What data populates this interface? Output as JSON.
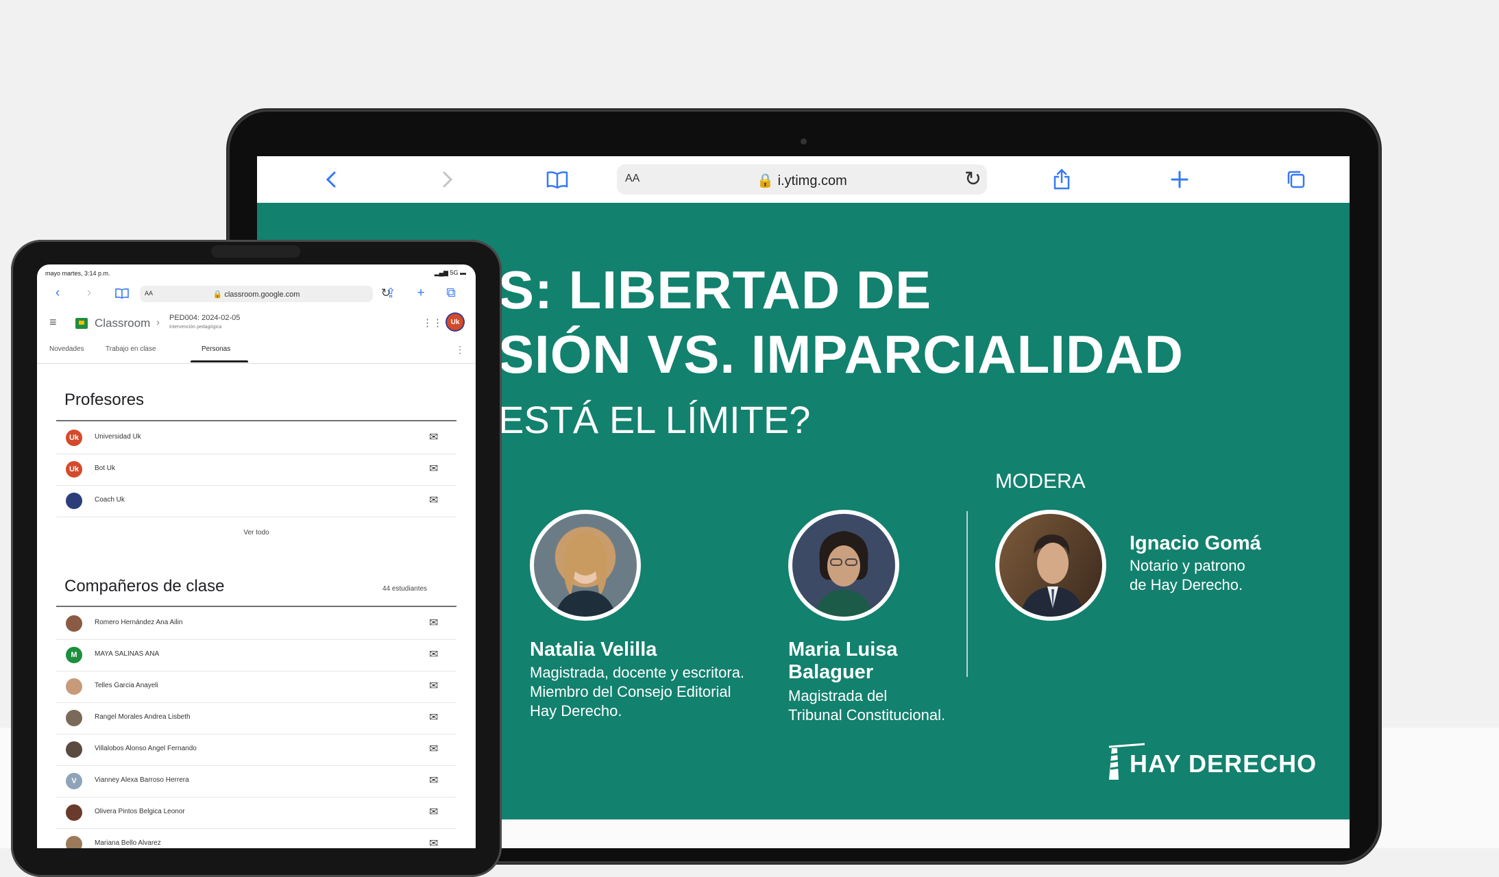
{
  "laptop_browser": {
    "text_size_label": "AA",
    "url": "i.ytimg.com",
    "icons": [
      "back-icon",
      "forward-icon",
      "bookmarks-icon",
      "reload-icon",
      "share-icon",
      "new-tab-icon",
      "tabs-icon"
    ]
  },
  "slide": {
    "title_line1": "S: LIBERTAD DE",
    "title_line2": "SIÓN VS. IMPARCIALIDAD",
    "title_line3": "ESTÁ EL LÍMITE?",
    "modera_label": "MODERA",
    "background_color": "#12816e",
    "speakers": [
      {
        "name": "Natalia Velilla",
        "role_lines": [
          "Magistrada, docente y escritora.",
          "Miembro del Consejo Editorial",
          "Hay Derecho."
        ]
      },
      {
        "name_lines": [
          "Maria Luisa",
          "Balaguer"
        ],
        "role_lines": [
          "Magistrada del",
          "Tribunal Constitucional."
        ]
      }
    ],
    "moderator": {
      "name": "Ignacio Gomá",
      "role_lines": [
        "Notario y patrono",
        "de Hay Derecho."
      ]
    },
    "logo_text": "HAY DERECHO"
  },
  "tablet": {
    "status_time": "mayo martes, 3:14 p.m.",
    "status_right": "5G",
    "browser": {
      "text_size_label": "AA",
      "url": "classroom.google.com"
    },
    "app": {
      "name": "Classroom",
      "course": "PED004: 2024-02-05",
      "course_sub": "Intervención pedagógica",
      "account_initials": "Uk"
    },
    "tabs": [
      "Novedades",
      "Trabajo en clase",
      "Personas"
    ],
    "active_tab": "Personas",
    "teachers_title": "Profesores",
    "teachers": [
      {
        "name": "Universidad Uk",
        "avatar_text": "Uk",
        "avatar_color": "#d44a2a"
      },
      {
        "name": "Bot Uk",
        "avatar_text": "Uk",
        "avatar_color": "#d44a2a"
      },
      {
        "name": "Coach Uk",
        "avatar_text": "",
        "avatar_color": "#2c3e7a"
      }
    ],
    "see_all": "Ver todo",
    "classmates_title": "Compañeros de clase",
    "classmates_count": "44 estudiantes",
    "classmates": [
      {
        "name": "Romero Hernández Ana Ailin",
        "avatar_text": "",
        "avatar_color": "#8a5a44"
      },
      {
        "name": "MAYA SALINAS ANA",
        "avatar_text": "M",
        "avatar_color": "#1e8e3e"
      },
      {
        "name": "Telles Garcia Anayeli",
        "avatar_text": "",
        "avatar_color": "#c79a7a"
      },
      {
        "name": "Rangel Morales Andrea Lisbeth",
        "avatar_text": "",
        "avatar_color": "#7a6a5a"
      },
      {
        "name": "Villalobos Alonso Angel Fernando",
        "avatar_text": "",
        "avatar_color": "#5a4a40"
      },
      {
        "name": "Vianney Alexa Barroso Herrera",
        "avatar_text": "V",
        "avatar_color": "#8fa4b8"
      },
      {
        "name": "Olivera Pintos Belgica Leonor",
        "avatar_text": "",
        "avatar_color": "#6a3a2a"
      },
      {
        "name": "Mariana Bello Alvarez",
        "avatar_text": "",
        "avatar_color": "#9a7a5a"
      }
    ]
  }
}
